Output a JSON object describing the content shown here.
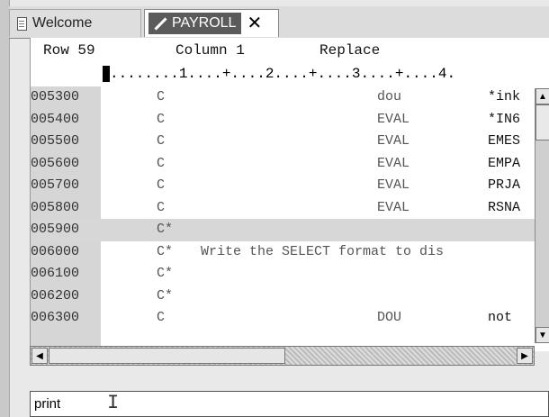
{
  "tabs": {
    "welcome_label": "Welcome",
    "payroll_label": "PAYROLL",
    "close_glyph": "✕"
  },
  "status": {
    "row": "Row 59",
    "column": "Column 1",
    "mode": "Replace"
  },
  "ruler": "........1....+....2....+....3....+....4.",
  "rows": [
    {
      "seq": "005300",
      "spec": "C",
      "op": "dou",
      "f2": "*ink"
    },
    {
      "seq": "005400",
      "spec": "C",
      "op": "EVAL",
      "f2": "*IN6"
    },
    {
      "seq": "005500",
      "spec": "C",
      "op": "EVAL",
      "f2": "EMES"
    },
    {
      "seq": "005600",
      "spec": "C",
      "op": "EVAL",
      "f2": "EMPA"
    },
    {
      "seq": "005700",
      "spec": "C",
      "op": "EVAL",
      "f2": "PRJA"
    },
    {
      "seq": "005800",
      "spec": "C",
      "op": "EVAL",
      "f2": "RSNA"
    },
    {
      "seq": "005900",
      "spec": "C*",
      "op": "",
      "f2": ""
    },
    {
      "seq": "006000",
      "spec": "C*",
      "comment": "Write the SELECT format to dis"
    },
    {
      "seq": "006100",
      "spec": "C*",
      "op": "",
      "f2": ""
    },
    {
      "seq": "006200",
      "spec": "C*",
      "op": "",
      "f2": ""
    },
    {
      "seq": "006300",
      "spec": "C",
      "op": "DOU",
      "f2": "not"
    }
  ],
  "command_line": {
    "value": "print"
  }
}
